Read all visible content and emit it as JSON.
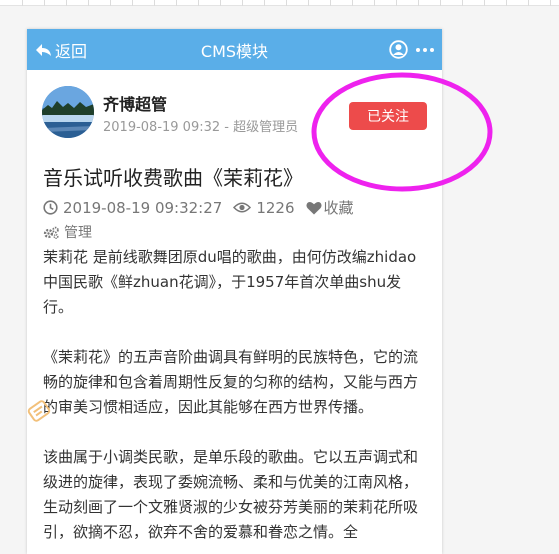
{
  "nav": {
    "back_label": "返回",
    "title": "CMS模块",
    "user_icon": "user-circle-icon",
    "more_icon": "more-dots-icon"
  },
  "author": {
    "name": "齐博超管",
    "meta": "2019-08-19 09:32 - 超级管理员",
    "follow_label": "已关注"
  },
  "article": {
    "title": "音乐试听收费歌曲《茉莉花》",
    "datetime": "2019-08-19 09:32:27",
    "views": "1226",
    "favorite_label": "收藏",
    "manage_label": "管理",
    "paragraphs": [
      "茉莉花 是前线歌舞团原du唱的歌曲，由何仿改编zhidao中国民歌《鲜zhuan花调》，于1957年首次单曲shu发行。",
      "《茉莉花》的五声音阶曲调具有鲜明的民族特色，它的流畅的旋律和包含着周期性反复的匀称的结构，又能与西方的审美习惯相适应，因此其能够在西方世界传播。",
      "该曲属于小调类民歌，是单乐段的歌曲。它以五声调式和级进的旋律，表现了委婉流畅、柔和与优美的江南风格，生动刻画了一个文雅贤淑的少女被芬芳美丽的茉莉花所吸引，欲摘不忍，欲弃不舍的爱慕和眷恋之情。全"
    ]
  },
  "colors": {
    "navbar": "#5aaee8",
    "follow_button": "#ed4b4b",
    "annotation": "#ee22ee"
  }
}
